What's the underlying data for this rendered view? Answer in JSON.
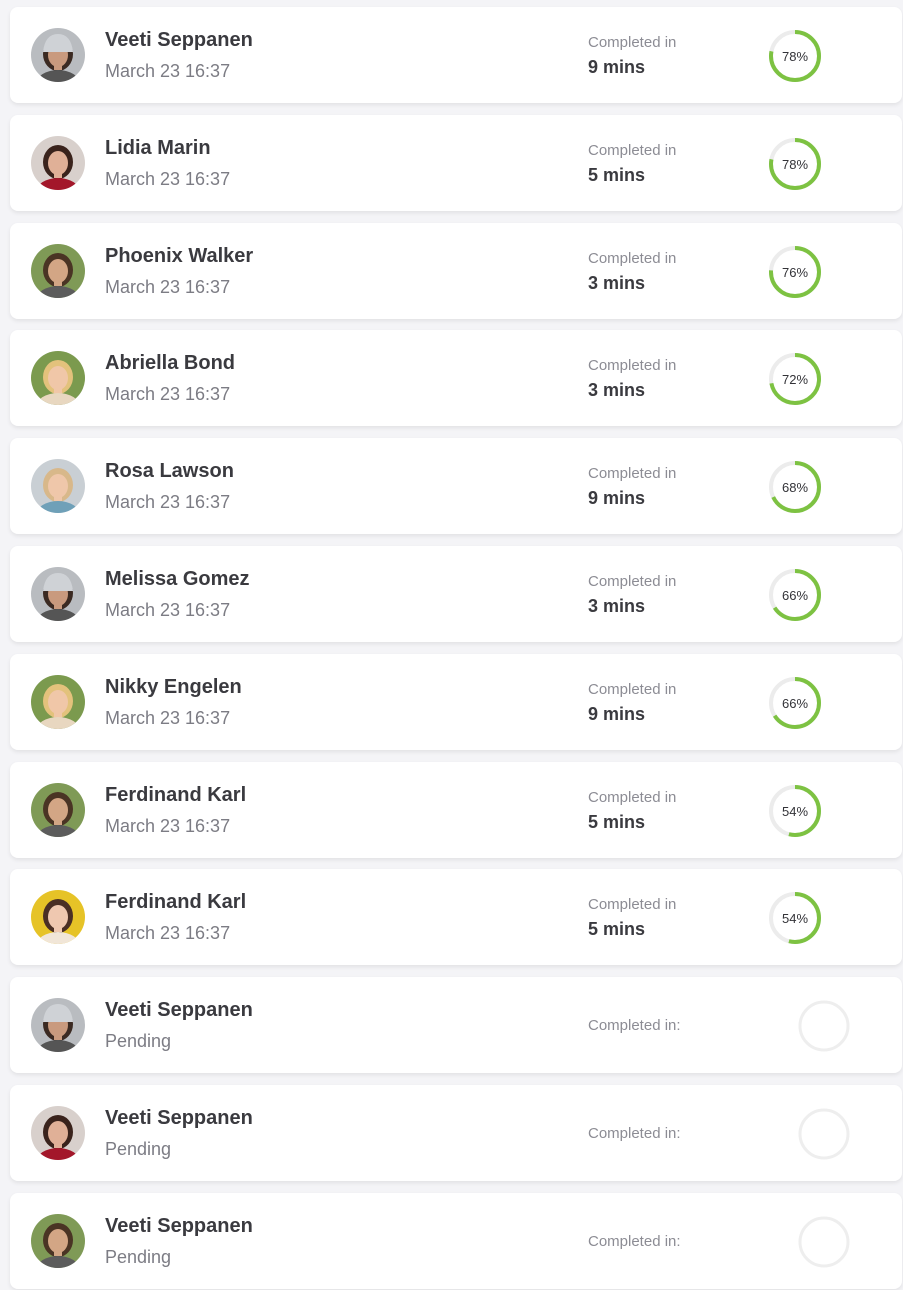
{
  "colors": {
    "progress": "#7dc242",
    "track": "#ececec",
    "empty_ring": "#eeeeee"
  },
  "results": [
    {
      "name": "Veeti Seppanen",
      "date": "March 23 16:37",
      "status_label": "Completed  in",
      "duration": "9 mins",
      "score_label": "78%",
      "score": 78,
      "pending": false,
      "avatar": "woman-gray-beanie"
    },
    {
      "name": "Lidia Marin",
      "date": "March 23 16:37",
      "status_label": "Completed  in",
      "duration": "5 mins",
      "score_label": "78%",
      "score": 78,
      "pending": false,
      "avatar": "woman-red-top"
    },
    {
      "name": "Phoenix Walker",
      "date": "March 23 16:37",
      "status_label": "Completed  in",
      "duration": "3 mins",
      "score_label": "76%",
      "score": 76,
      "pending": false,
      "avatar": "man-short-hair"
    },
    {
      "name": "Abriella Bond",
      "date": "March 23 16:37",
      "status_label": "Completed  in",
      "duration": "3 mins",
      "score_label": "72%",
      "score": 72,
      "pending": false,
      "avatar": "woman-blonde"
    },
    {
      "name": "Rosa Lawson",
      "date": "March 23 16:37",
      "status_label": "Completed  in",
      "duration": "9 mins",
      "score_label": "68%",
      "score": 68,
      "pending": false,
      "avatar": "woman-blonde-2"
    },
    {
      "name": "Melissa Gomez",
      "date": "March 23 16:37",
      "status_label": "Completed  in",
      "duration": "3 mins",
      "score_label": "66%",
      "score": 66,
      "pending": false,
      "avatar": "woman-gray-beanie"
    },
    {
      "name": "Nikky Engelen",
      "date": "March 23 16:37",
      "status_label": "Completed  in",
      "duration": "9 mins",
      "score_label": "66%",
      "score": 66,
      "pending": false,
      "avatar": "woman-blonde"
    },
    {
      "name": "Ferdinand Karl",
      "date": "March 23 16:37",
      "status_label": "Completed  in",
      "duration": "5 mins",
      "score_label": "54%",
      "score": 54,
      "pending": false,
      "avatar": "man-short-hair"
    },
    {
      "name": "Ferdinand Karl",
      "date": "March 23 16:37",
      "status_label": "Completed  in",
      "duration": "5 mins",
      "score_label": "54%",
      "score": 54,
      "pending": false,
      "avatar": "woman-yellow-bg"
    },
    {
      "name": "Veeti Seppanen",
      "date": "Pending",
      "status_label": "Completed in:",
      "duration": "",
      "score_label": "",
      "score": null,
      "pending": true,
      "avatar": "woman-gray-beanie"
    },
    {
      "name": "Veeti Seppanen",
      "date": "Pending",
      "status_label": "Completed in:",
      "duration": "",
      "score_label": "",
      "score": null,
      "pending": true,
      "avatar": "woman-red-top"
    },
    {
      "name": "Veeti Seppanen",
      "date": "Pending",
      "status_label": "Completed in:",
      "duration": "",
      "score_label": "",
      "score": null,
      "pending": true,
      "avatar": "man-short-hair"
    }
  ]
}
